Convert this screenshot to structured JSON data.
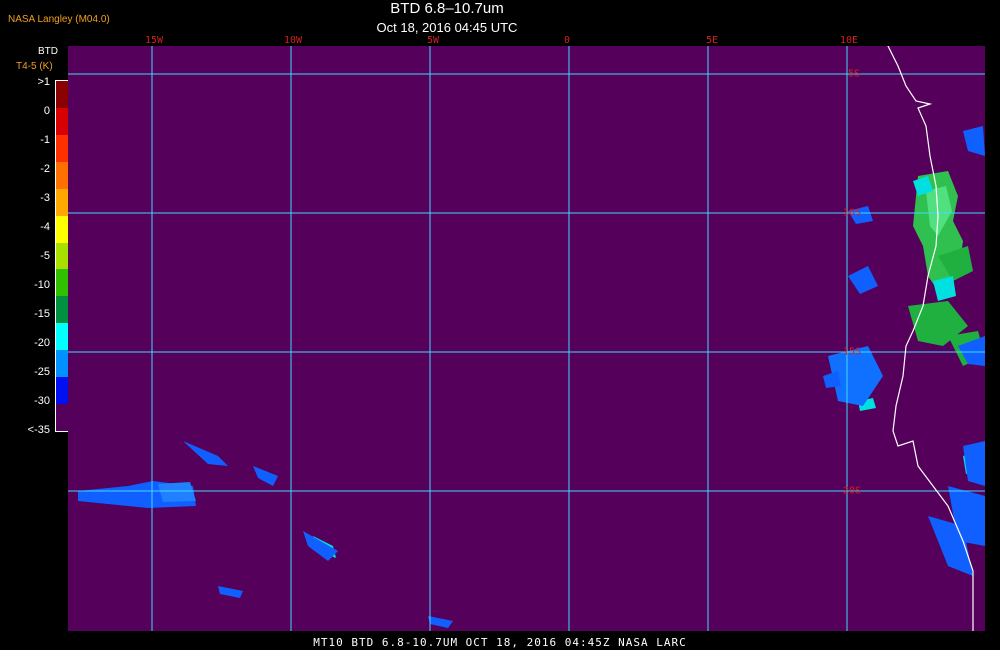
{
  "producer": "NASA Langley (M04.0)",
  "title": "BTD 6.8–10.7um",
  "subtitle": "Oct 18, 2016 04:45 UTC",
  "footer": "MT10  BTD 6.8-10.7UM   OCT 18, 2016 04:45Z   NASA LARC",
  "legend": {
    "title": "BTD",
    "unit": "T4-5 (K)",
    "ticks": [
      ">1",
      "0",
      "-1",
      "-2",
      "-3",
      "-4",
      "-5",
      "-10",
      "-15",
      "-20",
      "-25",
      "-30",
      "<-35"
    ],
    "colors": [
      "#8b0000",
      "#d80000",
      "#ff3000",
      "#ff7000",
      "#ffa800",
      "#ffff00",
      "#a8e000",
      "#30c000",
      "#009040",
      "#00ffff",
      "#0090ff",
      "#0010f0",
      "#55005a"
    ]
  },
  "grid": {
    "longitudes": [
      "15W",
      "10W",
      "5W",
      "0",
      "5E",
      "10E"
    ],
    "latitudes": [
      "5S",
      "10S",
      "15S",
      "20S"
    ]
  },
  "colors": {
    "background": "#55005a",
    "gridline": "#40d8ff",
    "labels": "#d42020",
    "coastline": "#ffffff"
  }
}
